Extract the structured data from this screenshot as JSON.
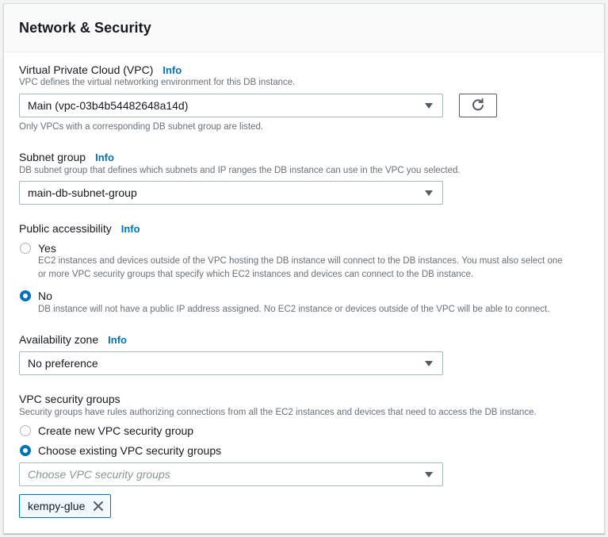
{
  "panel": {
    "title": "Network & Security"
  },
  "vpc": {
    "label": "Virtual Private Cloud (VPC)",
    "info": "Info",
    "description": "VPC defines the virtual networking environment for this DB instance.",
    "selected": "Main (vpc-03b4b54482648a14d)",
    "hint": "Only VPCs with a corresponding DB subnet group are listed."
  },
  "subnet": {
    "label": "Subnet group",
    "info": "Info",
    "description": "DB subnet group that defines which subnets and IP ranges the DB instance can use in the VPC you selected.",
    "selected": "main-db-subnet-group"
  },
  "public_access": {
    "label": "Public accessibility",
    "info": "Info",
    "options": [
      {
        "label": "Yes",
        "checked": false,
        "description_line1": "EC2 instances and devices outside of the VPC hosting the DB instance will connect to the DB instances. You must also select one",
        "description_line2": "or more VPC security groups that specify which EC2 instances and devices can connect to the DB instance."
      },
      {
        "label": "No",
        "checked": true,
        "description_line1": "DB instance will not have a public IP address assigned. No EC2 instance or devices outside of the VPC will be able to connect."
      }
    ]
  },
  "az": {
    "label": "Availability zone",
    "info": "Info",
    "selected": "No preference"
  },
  "security_groups": {
    "label": "VPC security groups",
    "description": "Security groups have rules authorizing connections from all the EC2 instances and devices that need to access the DB instance.",
    "options": [
      {
        "label": "Create new VPC security group",
        "checked": false
      },
      {
        "label": "Choose existing VPC security groups",
        "checked": true
      }
    ],
    "placeholder": "Choose VPC security groups",
    "tokens": [
      "kempy-glue"
    ]
  },
  "colors": {
    "accent": "#0073bb",
    "text": "#16191f",
    "muted": "#687078",
    "border": "#aab7b8"
  }
}
